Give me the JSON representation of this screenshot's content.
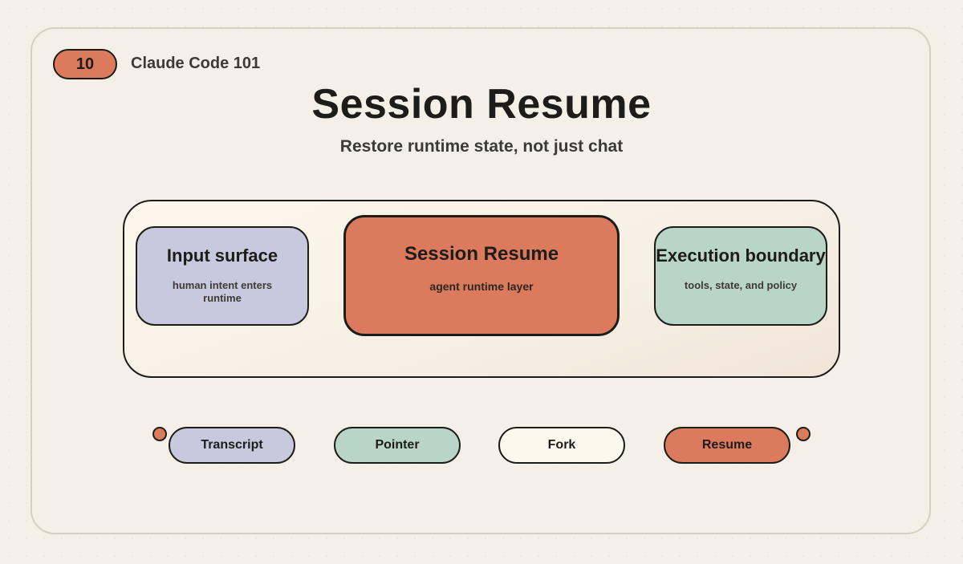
{
  "header": {
    "badge_number": "10",
    "series": "Claude Code 101",
    "title": "Session Resume",
    "subtitle": "Restore runtime state, not just chat"
  },
  "diagram": {
    "nodes": [
      {
        "title": "Input surface",
        "description": "human intent enters runtime",
        "color": "#c8c9de"
      },
      {
        "title": "Session Resume",
        "description": "agent runtime layer",
        "color": "#db7a5c"
      },
      {
        "title": "Execution boundary",
        "description": "tools, state, and policy",
        "color": "#b8d5c8"
      }
    ]
  },
  "legend": {
    "items": [
      {
        "label": "Transcript",
        "color": "#c8c9de"
      },
      {
        "label": "Pointer",
        "color": "#b8d5c8"
      },
      {
        "label": "Fork",
        "color": "#fdf8ee"
      },
      {
        "label": "Resume",
        "color": "#db7a5c"
      }
    ]
  },
  "colors": {
    "accent": "#db7a5c",
    "background": "#f4f0e8",
    "ink": "#1e1c19"
  }
}
